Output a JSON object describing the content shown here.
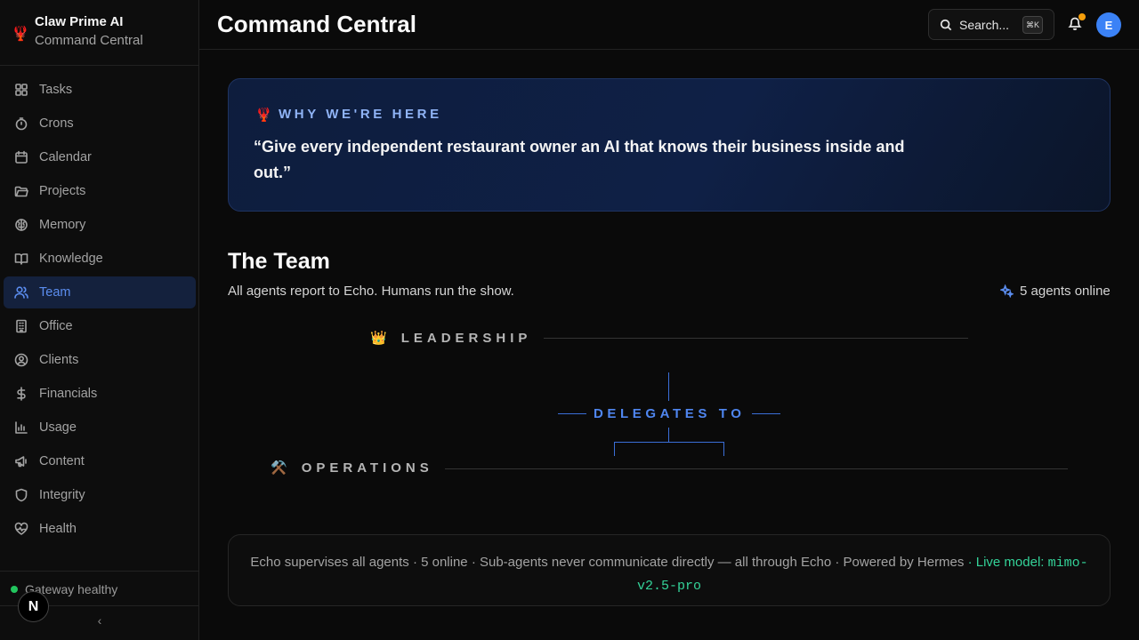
{
  "sidebar": {
    "brand_title": "Claw Prime AI",
    "brand_subtitle": "Command Central",
    "items": [
      {
        "label": "Tasks",
        "icon": "grid-icon"
      },
      {
        "label": "Crons",
        "icon": "timer-icon"
      },
      {
        "label": "Calendar",
        "icon": "calendar-icon"
      },
      {
        "label": "Projects",
        "icon": "folder-icon"
      },
      {
        "label": "Memory",
        "icon": "brain-icon"
      },
      {
        "label": "Knowledge",
        "icon": "book-icon"
      },
      {
        "label": "Team",
        "icon": "users-icon",
        "active": true
      },
      {
        "label": "Office",
        "icon": "building-icon"
      },
      {
        "label": "Clients",
        "icon": "user-circle-icon"
      },
      {
        "label": "Financials",
        "icon": "dollar-icon"
      },
      {
        "label": "Usage",
        "icon": "bar-chart-icon"
      },
      {
        "label": "Content",
        "icon": "megaphone-icon"
      },
      {
        "label": "Integrity",
        "icon": "shield-icon"
      },
      {
        "label": "Health",
        "icon": "heart-pulse-icon"
      }
    ],
    "gateway_status": "Gateway healthy",
    "collapse_glyph": "‹",
    "n_badge": "N"
  },
  "header": {
    "title": "Command Central",
    "search_label": "Search...",
    "search_shortcut": "⌘K",
    "avatar_initial": "E"
  },
  "mission": {
    "label": "WHY WE'RE HERE",
    "quote": "“Give every independent restaurant owner an AI that knows their business inside and out.”"
  },
  "team": {
    "title": "The Team",
    "subtitle": "All agents report to Echo. Humans run the show.",
    "online": "5 agents online",
    "leadership_label": "LEADERSHIP",
    "leadership_emoji": "👑",
    "delegates_label": "DELEGATES TO",
    "operations_label": "OPERATIONS",
    "operations_emoji": "⚒️"
  },
  "footer": {
    "text": "Echo supervises all agents · 5 online · Sub-agents never communicate directly — all through Echo · Powered by Hermes",
    "live_prefix": " · Live model:",
    "live_model": "mimo-v2.5-pro"
  },
  "colors": {
    "accent": "#5b8def",
    "active_bg": "#14213d",
    "healthy": "#22c55e",
    "notification": "#f59e0b",
    "brand_red": "#e0452b"
  }
}
